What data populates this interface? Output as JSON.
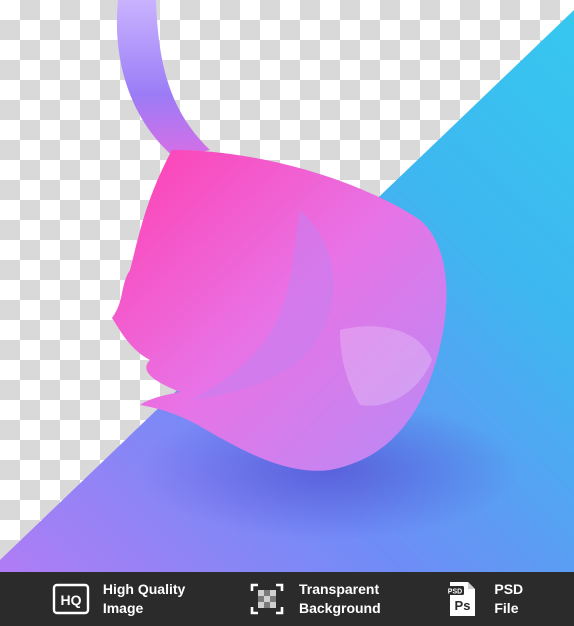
{
  "footer": {
    "badges": [
      {
        "icon": "hq-icon",
        "line1": "High Quality",
        "line2": "Image"
      },
      {
        "icon": "transparency-icon",
        "line1": "Transparent",
        "line2": "Background"
      },
      {
        "icon": "psd-file-icon",
        "line1": "PSD",
        "line2": "File",
        "icon_label_top": "PSD",
        "icon_label_main": "Ps"
      }
    ],
    "hq_icon_text": "HQ"
  },
  "colors": {
    "blue_surface": "#3fb6f0",
    "pink_ribbon": "#ff5fd0",
    "violet": "#9a6cff",
    "footer_bg": "#2b2b2b"
  }
}
